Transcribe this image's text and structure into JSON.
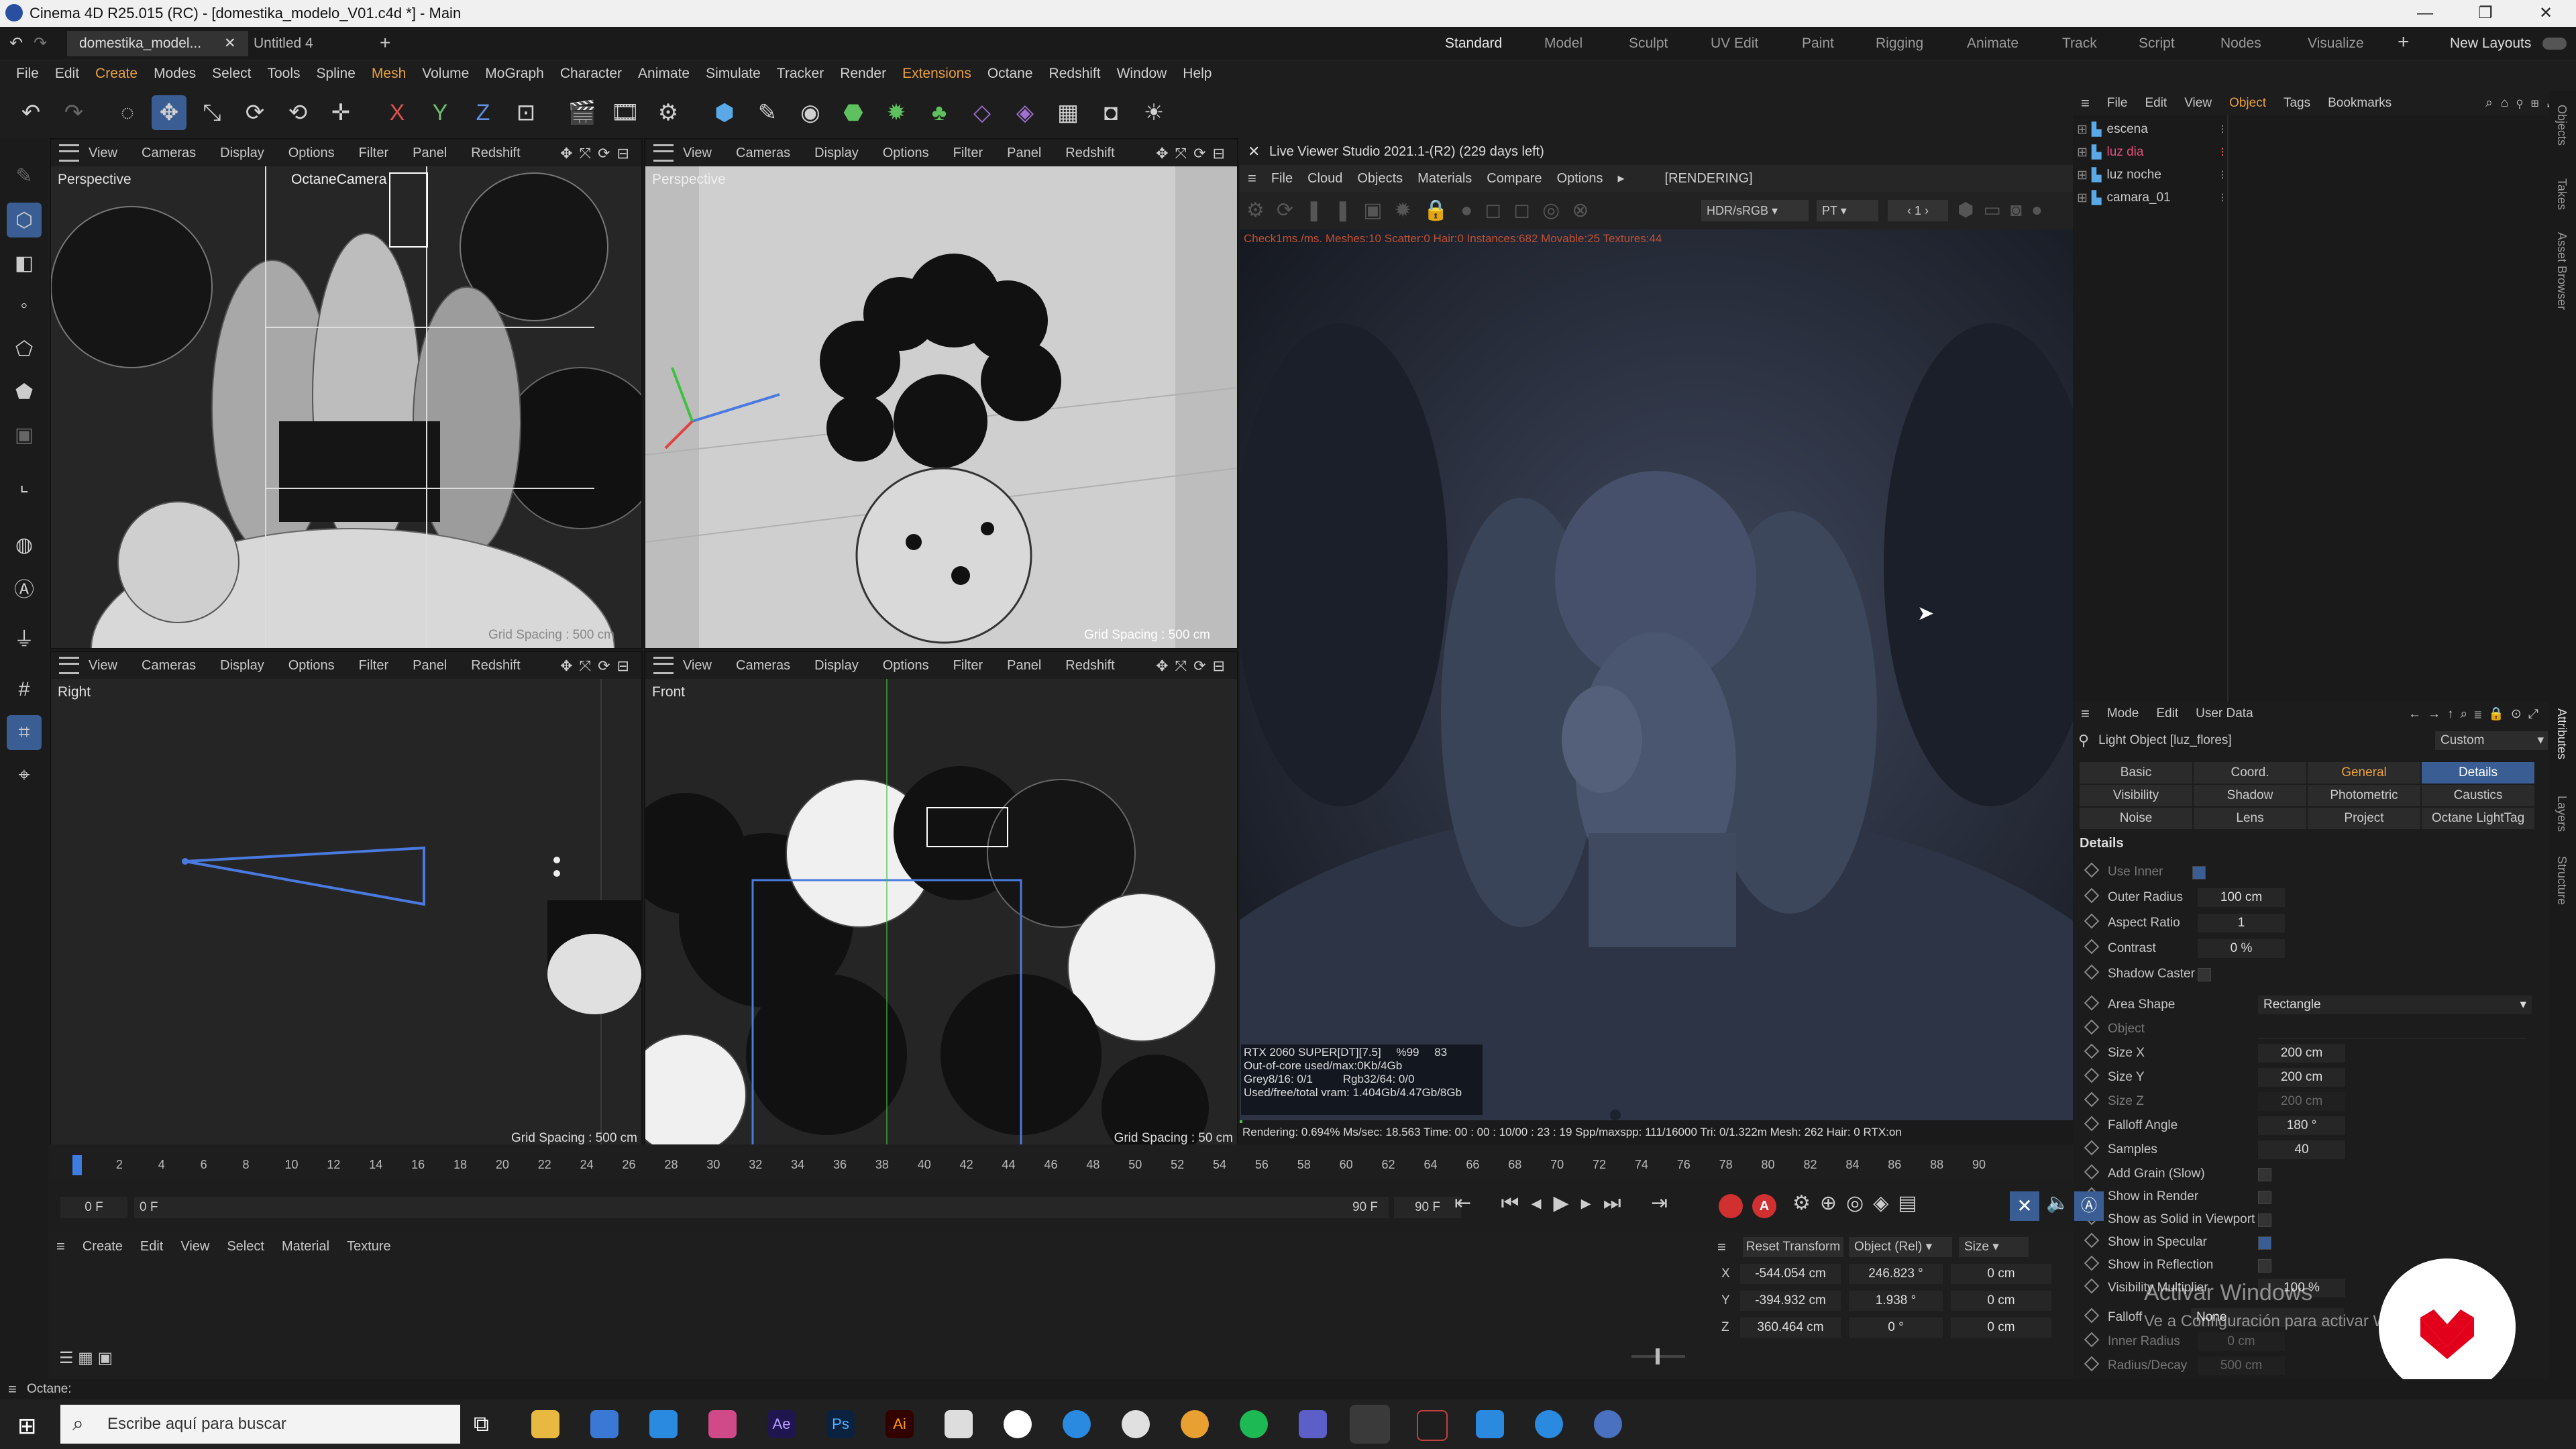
{
  "window": {
    "title": "Cinema 4D R25.015 (RC) - [domestika_modelo_V01.c4d *] - Main",
    "controls": [
      "—",
      "❐",
      "✕"
    ]
  },
  "doc_tabs": [
    {
      "label": "domestika_model..."
    },
    {
      "label": "Untitled 4"
    }
  ],
  "layouts": {
    "items": [
      "Standard",
      "Model",
      "Sculpt",
      "UV Edit",
      "Paint",
      "Rigging",
      "Animate",
      "Track",
      "Script",
      "Nodes",
      "Visualize"
    ],
    "active": "Standard",
    "new_layouts": "New Layouts"
  },
  "menu": [
    "File",
    "Edit",
    "Create",
    "Modes",
    "Select",
    "Tools",
    "Spline",
    "Mesh",
    "Volume",
    "MoGraph",
    "Character",
    "Animate",
    "Simulate",
    "Tracker",
    "Render",
    "Extensions",
    "Octane",
    "Redshift",
    "Window",
    "Help"
  ],
  "viewport_menu": [
    "View",
    "Cameras",
    "Display",
    "Options",
    "Filter",
    "Panel",
    "Redshift"
  ],
  "viewports": [
    {
      "label": "Perspective",
      "camera": "OctaneCamera",
      "grid": "Grid Spacing : 500 cm"
    },
    {
      "label": "Perspective",
      "camera": "",
      "grid": "Grid Spacing : 500 cm"
    },
    {
      "label": "Right",
      "camera": "",
      "grid": "Grid Spacing : 500 cm"
    },
    {
      "label": "Front",
      "camera": "",
      "grid": "Grid Spacing : 50 cm"
    }
  ],
  "live_viewer": {
    "title": "Live Viewer Studio 2021.1-(R2) (229 days left)",
    "menu": [
      "File",
      "Cloud",
      "Objects",
      "Materials",
      "Compare",
      "Options"
    ],
    "status": "[RENDERING]",
    "colorspace": "HDR/sRGB",
    "mode": "PT",
    "page": "1",
    "check_line": "Check1ms./ms. Meshes:10 Scatter:0 Hair:0 Instances:682 Movable:25 Textures:44",
    "stats": {
      "gpu": "RTX 2060 SUPER[DT][7.5]",
      "gpu_pct": "%99",
      "gpu_temp": "83",
      "ooc": "Out-of-core used/max:0Kb/4Gb",
      "grey": "Grey8/16: 0/1",
      "rgb": "Rgb32/64: 0/0",
      "vram": "Used/free/total vram: 1.404Gb/4.47Gb/8Gb"
    },
    "render_line": "Rendering: 0.694%   Ms/sec: 18.563   Time: 00 : 00 : 10/00 : 23 : 19   Spp/maxspp: 111/16000   Tri: 0/1.322m   Mesh: 262   Hair: 0   RTX:on"
  },
  "object_manager": {
    "menu": [
      "File",
      "Edit",
      "View",
      "Object",
      "Tags",
      "Bookmarks"
    ],
    "objects": [
      {
        "name": "escena",
        "color": "#c8c8c8"
      },
      {
        "name": "luz dia",
        "color": "#e0507a"
      },
      {
        "name": "luz noche",
        "color": "#c8c8c8"
      },
      {
        "name": "camara_01",
        "color": "#c8c8c8"
      }
    ]
  },
  "attributes": {
    "menu": [
      "Mode",
      "Edit",
      "User Data"
    ],
    "title": "Light Object [luz_flores]",
    "preset": "Custom",
    "tabs": [
      "Basic",
      "Coord.",
      "General",
      "Details",
      "Visibility",
      "Shadow",
      "Photometric",
      "Caustics",
      "Noise",
      "Lens",
      "Project",
      "Octane LightTag"
    ],
    "selected_tabs": [
      "Details"
    ],
    "section": "Details",
    "props": [
      {
        "label": "Use Inner",
        "value": "",
        "type": "check",
        "on": true
      },
      {
        "label": "Outer Radius",
        "value": "100 cm",
        "type": "num"
      },
      {
        "label": "Aspect Ratio",
        "value": "1",
        "type": "num"
      },
      {
        "label": "Contrast",
        "value": "0 %",
        "type": "num"
      },
      {
        "label": "Shadow Caster",
        "value": "",
        "type": "check",
        "on": false
      },
      {
        "label": "Area Shape",
        "value": "Rectangle",
        "type": "select"
      },
      {
        "label": "Object",
        "value": "",
        "type": "link"
      },
      {
        "label": "Size X",
        "value": "200 cm",
        "type": "num"
      },
      {
        "label": "Size Y",
        "value": "200 cm",
        "type": "num"
      },
      {
        "label": "Size Z",
        "value": "200 cm",
        "type": "num"
      },
      {
        "label": "Falloff Angle",
        "value": "180 °",
        "type": "num"
      },
      {
        "label": "Samples",
        "value": "40",
        "type": "num"
      },
      {
        "label": "Add Grain (Slow)",
        "value": "",
        "type": "check",
        "on": false
      },
      {
        "label": "Show in Render",
        "value": "",
        "type": "check",
        "on": false
      },
      {
        "label": "Show as Solid in Viewport",
        "value": "",
        "type": "check",
        "on": false
      },
      {
        "label": "Show in Specular",
        "value": "",
        "type": "check",
        "on": true
      },
      {
        "label": "Show in Reflection",
        "value": "",
        "type": "check",
        "on": false
      },
      {
        "label": "Visibility Multiplier",
        "value": "100 %",
        "type": "num"
      },
      {
        "label": "Falloff",
        "value": "None",
        "type": "select"
      },
      {
        "label": "Inner Radius",
        "value": "0 cm",
        "type": "num"
      },
      {
        "label": "Radius/Decay",
        "value": "500 cm",
        "type": "num"
      }
    ]
  },
  "timeline": {
    "ticks": [
      "0",
      "2",
      "4",
      "6",
      "8",
      "10",
      "12",
      "14",
      "16",
      "18",
      "20",
      "22",
      "24",
      "26",
      "28",
      "30",
      "32",
      "34",
      "36",
      "38",
      "40",
      "42",
      "44",
      "46",
      "48",
      "50",
      "52",
      "54",
      "56",
      "58",
      "60",
      "62",
      "64",
      "66",
      "68",
      "70",
      "72",
      "74",
      "76",
      "78",
      "80",
      "82",
      "84",
      "86",
      "88",
      "90"
    ],
    "current_frame": "0 F",
    "start": "0 F",
    "end_label": "90 F",
    "end_field": "90 F",
    "playhead_frame": 0
  },
  "material_manager": {
    "menu": [
      "Create",
      "Edit",
      "View",
      "Select",
      "Material",
      "Texture"
    ]
  },
  "coords": {
    "reset": "Reset Transform",
    "mode": "Object (Rel)",
    "size_mode": "Size",
    "rows": [
      {
        "axis": "X",
        "pos": "-544.054 cm",
        "rot": "246.823 °",
        "size": "0 cm"
      },
      {
        "axis": "Y",
        "pos": "-394.932 cm",
        "rot": "1.938 °",
        "size": "0 cm"
      },
      {
        "axis": "Z",
        "pos": "360.464 cm",
        "rot": "0 °",
        "size": "0 cm"
      }
    ]
  },
  "status_bar": "Octane:",
  "watermark": {
    "line1": "Activar Windows",
    "line2": "Ve a Configuración para activar Windows."
  },
  "taskbar": {
    "search_placeholder": "Escribe aquí para buscar"
  },
  "side_tabs": [
    "Objects",
    "Takes",
    "Asset Browser",
    "Attributes",
    "Layers",
    "Structure"
  ]
}
